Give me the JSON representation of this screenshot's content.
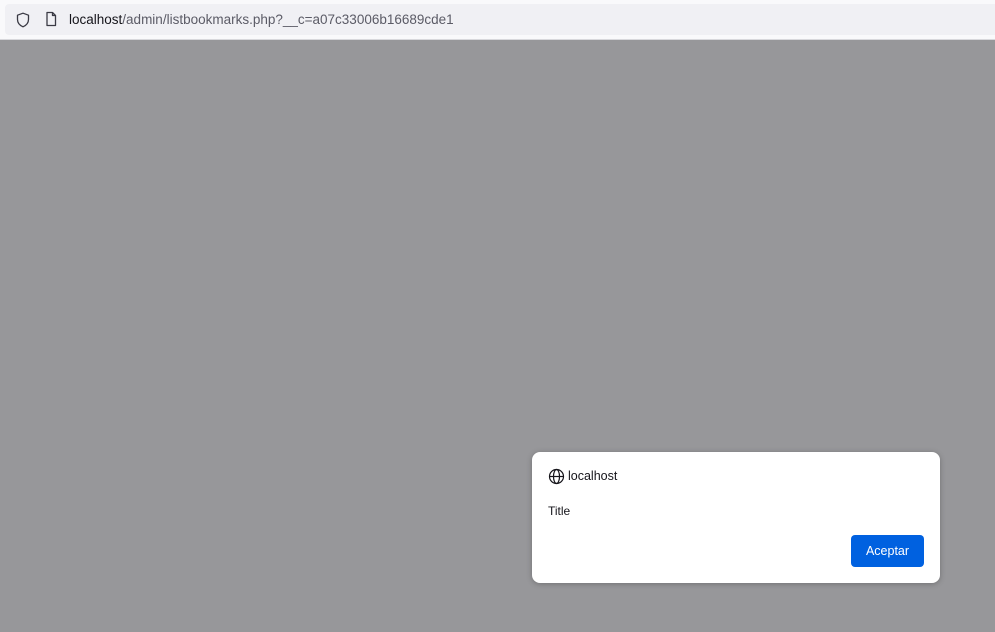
{
  "browser": {
    "url_host": "localhost",
    "url_path": "/admin/listbookmarks.php?__c=a07c33006b16689cde1",
    "icons": {
      "shield": "shield-icon",
      "page": "page-icon"
    }
  },
  "alert_dialog": {
    "origin": "localhost",
    "message": "Title",
    "ok_label": "Aceptar",
    "accent_color": "#0061e0",
    "icon": "globe-icon"
  }
}
